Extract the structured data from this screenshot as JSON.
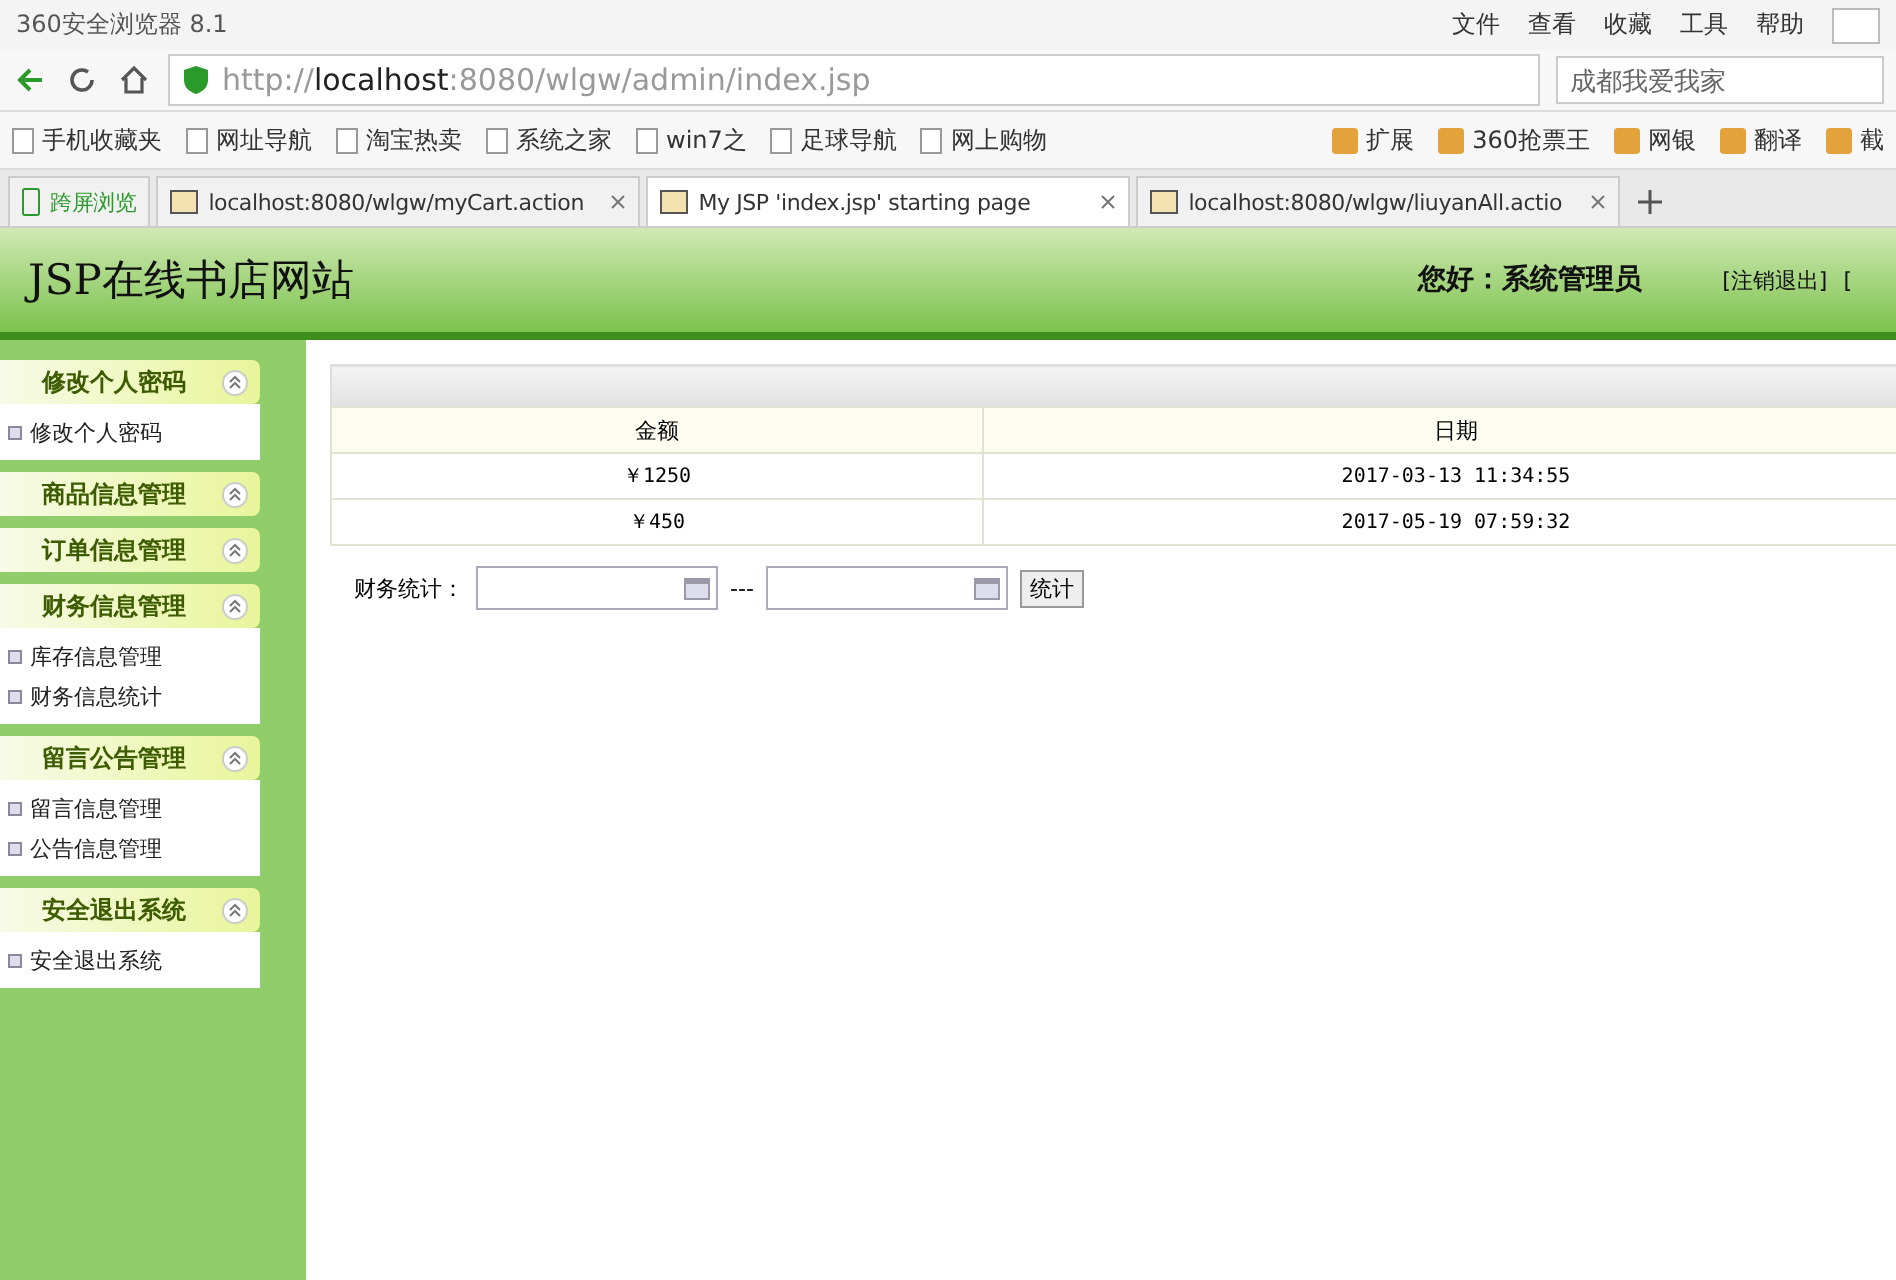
{
  "browser": {
    "title": "360安全浏览器 8.1",
    "menu": [
      "文件",
      "查看",
      "收藏",
      "工具",
      "帮助"
    ],
    "address": "http://**localhost**:8080/wlgw/admin/index.jsp",
    "search": {
      "placeholder": "成都我爱我家"
    },
    "bookmarks": [
      "手机收藏夹",
      "网址导航",
      "淘宝热卖",
      "系统之家",
      "win7之",
      "足球导航",
      "网上购物"
    ],
    "extensions": [
      "扩展",
      "360抢票王",
      "网银",
      "翻译",
      "截"
    ],
    "tabs": [
      {
        "label": "跨屏浏览",
        "kind": "special",
        "selected": false
      },
      {
        "label": "localhost:8080/wlgw/myCart.action",
        "kind": "page",
        "selected": false
      },
      {
        "label": "My JSP 'index.jsp' starting page",
        "kind": "page",
        "selected": true
      },
      {
        "label": "localhost:8080/wlgw/liuyanAll.actio",
        "kind": "page",
        "selected": false
      }
    ]
  },
  "header": {
    "site_title": "JSP在线书店网站",
    "greeting": "您好：系统管理员",
    "links": [
      "[注销退出]",
      "["
    ]
  },
  "sidebar": [
    {
      "title": "修改个人密码",
      "expanded": true,
      "items": [
        "修改个人密码"
      ]
    },
    {
      "title": "商品信息管理",
      "expanded": false
    },
    {
      "title": "订单信息管理",
      "expanded": false
    },
    {
      "title": "财务信息管理",
      "expanded": true,
      "items": [
        "库存信息管理",
        "财务信息统计"
      ]
    },
    {
      "title": "留言公告管理",
      "expanded": true,
      "items": [
        "留言信息管理",
        "公告信息管理"
      ]
    },
    {
      "title": "安全退出系统",
      "expanded": true,
      "items": [
        "安全退出系统"
      ]
    }
  ],
  "table": {
    "columns": [
      "金额",
      "日期"
    ],
    "rows": [
      [
        "￥1250",
        "2017-03-13 11:34:55"
      ],
      [
        "￥450",
        "2017-05-19 07:59:32"
      ]
    ]
  },
  "filter": {
    "label": "财务统计：",
    "separator": "---",
    "button": "统计"
  }
}
